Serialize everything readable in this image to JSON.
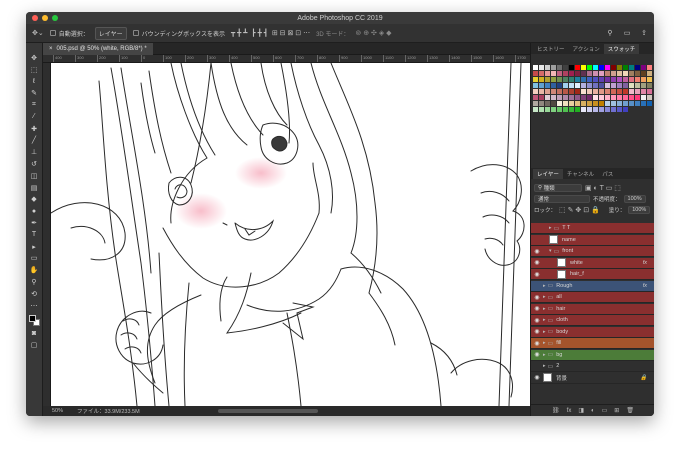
{
  "window": {
    "title": "Adobe Photoshop CC 2019"
  },
  "options_bar": {
    "auto_select_label": "自動選択：",
    "auto_select_value": "レイヤー",
    "bbox_label": "バウンディングボックスを表示",
    "mode3d_label": "3D モード："
  },
  "document": {
    "tab_label": "005.psd @ 50% (white, RGB/8*) *"
  },
  "ruler": {
    "ticks": [
      "400",
      "300",
      "200",
      "100",
      "0",
      "100",
      "200",
      "300",
      "400",
      "500",
      "600",
      "700",
      "800",
      "900",
      "1000",
      "1100",
      "1200",
      "1300",
      "1400",
      "1500",
      "1600",
      "1700",
      "1800",
      "1900",
      "2000",
      "2100"
    ]
  },
  "status": {
    "zoom": "50%",
    "file_info": "ファイル：33.9M/233.5M"
  },
  "color_panel": {
    "tabs": [
      "ヒストリー",
      "アクション",
      "スウォッチ"
    ],
    "active_tab": "スウォッチ",
    "swatch_colors": [
      "#ffffff",
      "#e8e8e8",
      "#cfcfcf",
      "#a0a0a0",
      "#6e6e6e",
      "#404040",
      "#000000",
      "#ff0000",
      "#ffff00",
      "#00ff00",
      "#00ffff",
      "#0000ff",
      "#ff00ff",
      "#7f0000",
      "#7f7f00",
      "#007f00",
      "#007f7f",
      "#00007f",
      "#7f007f",
      "#ff7f7f",
      "#c54a4a",
      "#d46a6a",
      "#e89898",
      "#f2b6b6",
      "#c06080",
      "#b04060",
      "#a02050",
      "#802040",
      "#603050",
      "#b07090",
      "#d090b0",
      "#e0a0c0",
      "#c08070",
      "#d0a090",
      "#e0c0a0",
      "#f0d8b8",
      "#a08060",
      "#806040",
      "#604020",
      "#d0b080",
      "#e6d030",
      "#d0b020",
      "#b0a030",
      "#90a040",
      "#709050",
      "#508060",
      "#308070",
      "#2080a0",
      "#3070b0",
      "#4060c0",
      "#5050c0",
      "#6040b0",
      "#7030a0",
      "#9040b0",
      "#b050c0",
      "#c060a0",
      "#e07080",
      "#f08070",
      "#f0a060",
      "#f0c050",
      "#80c0e0",
      "#60a0d0",
      "#4080c0",
      "#3060a0",
      "#204080",
      "#a0d0f0",
      "#c0e0f8",
      "#e0f0ff",
      "#b0b0e0",
      "#9090d0",
      "#7070c0",
      "#5050a0",
      "#d8c0e0",
      "#c0a0d0",
      "#a080c0",
      "#8060a0",
      "#e0e0c0",
      "#c0c0a0",
      "#a0a080",
      "#808060",
      "#f4d0c0",
      "#e8b8a8",
      "#dca090",
      "#d08878",
      "#c47060",
      "#b85848",
      "#ac4030",
      "#a02818",
      "#f8e0d0",
      "#f0c8b8",
      "#e8b0a0",
      "#e09888",
      "#d88070",
      "#d06858",
      "#c85040",
      "#c03828",
      "#f0b8c8",
      "#e8a0b8",
      "#e088a8",
      "#d87098",
      "#c05878",
      "#a84060",
      "#e0d0d8",
      "#d0b8c8",
      "#c0a0b8",
      "#b088a8",
      "#a07098",
      "#905888",
      "#804078",
      "#702868",
      "#ffe0e8",
      "#ffc8d8",
      "#ffb0c8",
      "#ff98b8",
      "#ff80a8",
      "#ff6898",
      "#ff5088",
      "#ff3878",
      "#f0f0f0",
      "#d0c8c0",
      "#b0a8a0",
      "#908880",
      "#706860",
      "#504840",
      "#f8f0e0",
      "#f0e0c0",
      "#e8d0a0",
      "#e0c080",
      "#d8b060",
      "#d0a040",
      "#c89020",
      "#c08000",
      "#b8d0e8",
      "#a0c0e0",
      "#88b0d8",
      "#70a0d0",
      "#5890c8",
      "#4080c0",
      "#2870b8",
      "#1060b0",
      "#c8e8c8",
      "#b0e0b0",
      "#98d898",
      "#80d080",
      "#68c868",
      "#50c050",
      "#38b838",
      "#20b020",
      "#e8e8f8",
      "#d0d0f0",
      "#b8b8e8",
      "#a0a0e0",
      "#8888d8",
      "#7070d0",
      "#5858c8",
      "#4040c0"
    ]
  },
  "layers_panel": {
    "tabs": [
      "レイヤー",
      "チャンネル",
      "パス"
    ],
    "active_tab": "レイヤー",
    "filter_label": "種類",
    "blend_mode": "通常",
    "opacity_label": "不透明度：",
    "opacity_value": "100%",
    "lock_label": "ロック：",
    "fill_label": "塗り：",
    "fill_value": "100%",
    "layers": [
      {
        "name": "T T",
        "color": "#8a2f2f",
        "kind": "folder-collapsed",
        "fx": false,
        "eye": false
      },
      {
        "name": "name",
        "color": "#8a2f2f",
        "kind": "layer",
        "fx": false,
        "eye": false
      },
      {
        "name": "front",
        "color": "#8a2f2f",
        "kind": "folder-open",
        "fx": false,
        "eye": true
      },
      {
        "name": "white",
        "color": "#8a2f2f",
        "kind": "layer",
        "fx": true,
        "eye": true
      },
      {
        "name": "hair_f",
        "color": "#8a2f2f",
        "kind": "layer",
        "fx": false,
        "eye": true
      },
      {
        "name": "Rough",
        "color": "#3c5377",
        "kind": "folder-collapsed",
        "fx": true,
        "eye": false
      },
      {
        "name": "all",
        "color": "#8a2f2f",
        "kind": "folder-collapsed",
        "fx": false,
        "eye": true
      },
      {
        "name": "hair",
        "color": "#8a2f2f",
        "kind": "folder-collapsed",
        "fx": false,
        "eye": true
      },
      {
        "name": "cloth",
        "color": "#8a2f2f",
        "kind": "folder-collapsed",
        "fx": false,
        "eye": true
      },
      {
        "name": "body",
        "color": "#8a2f2f",
        "kind": "folder-collapsed",
        "fx": false,
        "eye": true
      },
      {
        "name": "fill",
        "color": "#a5542c",
        "kind": "folder-collapsed",
        "fx": false,
        "eye": true
      },
      {
        "name": "bg",
        "color": "#4c7c39",
        "kind": "folder-collapsed",
        "fx": false,
        "eye": true
      },
      {
        "name": "2",
        "color": "#2f2f2f",
        "kind": "folder-collapsed",
        "fx": false,
        "eye": false
      },
      {
        "name": "背景",
        "color": "#2f2f2f",
        "kind": "layer",
        "fx": false,
        "eye": true,
        "lock": true
      }
    ]
  },
  "icons": {
    "move": "✥",
    "search": "⚲",
    "eye": "◉",
    "lock": "🔒",
    "folder": "▭"
  }
}
